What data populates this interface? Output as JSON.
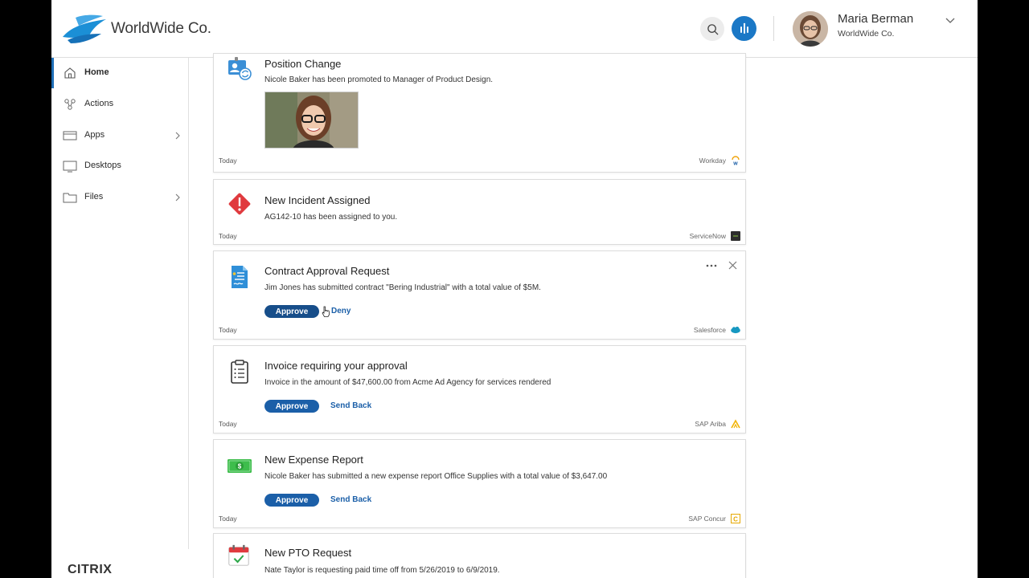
{
  "header": {
    "brand": "WorldWide Co.",
    "user": {
      "name": "Maria Berman",
      "org": "WorldWide Co."
    }
  },
  "sidebar": {
    "items": [
      {
        "label": "Home",
        "icon": "home-icon",
        "active": true
      },
      {
        "label": "Actions",
        "icon": "actions-icon"
      },
      {
        "label": "Apps",
        "icon": "apps-icon",
        "has_children": true
      },
      {
        "label": "Desktops",
        "icon": "desktop-icon"
      },
      {
        "label": "Files",
        "icon": "folder-icon",
        "has_children": true
      }
    ],
    "footer_logo": "CITRIX"
  },
  "feed": {
    "cards": [
      {
        "title": "Position Change",
        "description": "Nicole Baker has been promoted to Manager of Product Design.",
        "date": "Today",
        "source": "Workday",
        "icon": "position-change-icon"
      },
      {
        "title": "New Incident Assigned",
        "description": "AG142-10 has been assigned to you.",
        "date": "Today",
        "source": "ServiceNow",
        "icon": "incident-alert-icon"
      },
      {
        "title": "Contract Approval Request",
        "description": "Jim Jones has submitted contract \"Bering Industrial\" with a total value of $5M.",
        "date": "Today",
        "source": "Salesforce",
        "primary_action": "Approve",
        "secondary_action": "Deny",
        "icon": "contract-document-icon"
      },
      {
        "title": "Invoice requiring your approval",
        "description": "Invoice in the amount of $47,600.00 from Acme Ad Agency for services rendered",
        "date": "Today",
        "source": "SAP Ariba",
        "primary_action": "Approve",
        "secondary_action": "Send Back",
        "icon": "invoice-clipboard-icon"
      },
      {
        "title": "New Expense Report",
        "description": "Nicole Baker has submitted a new expense report Office Supplies with a total value of $3,647.00",
        "date": "Today",
        "source": "SAP Concur",
        "primary_action": "Approve",
        "secondary_action": "Send Back",
        "icon": "money-bill-icon"
      },
      {
        "title": "New PTO Request",
        "description": "Nate Taylor is requesting paid time off from 5/26/2019 to 6/9/2019.",
        "icon": "calendar-check-icon"
      }
    ]
  },
  "colors": {
    "accent": "#1b5fa8",
    "brand_blue": "#1b78c6"
  }
}
